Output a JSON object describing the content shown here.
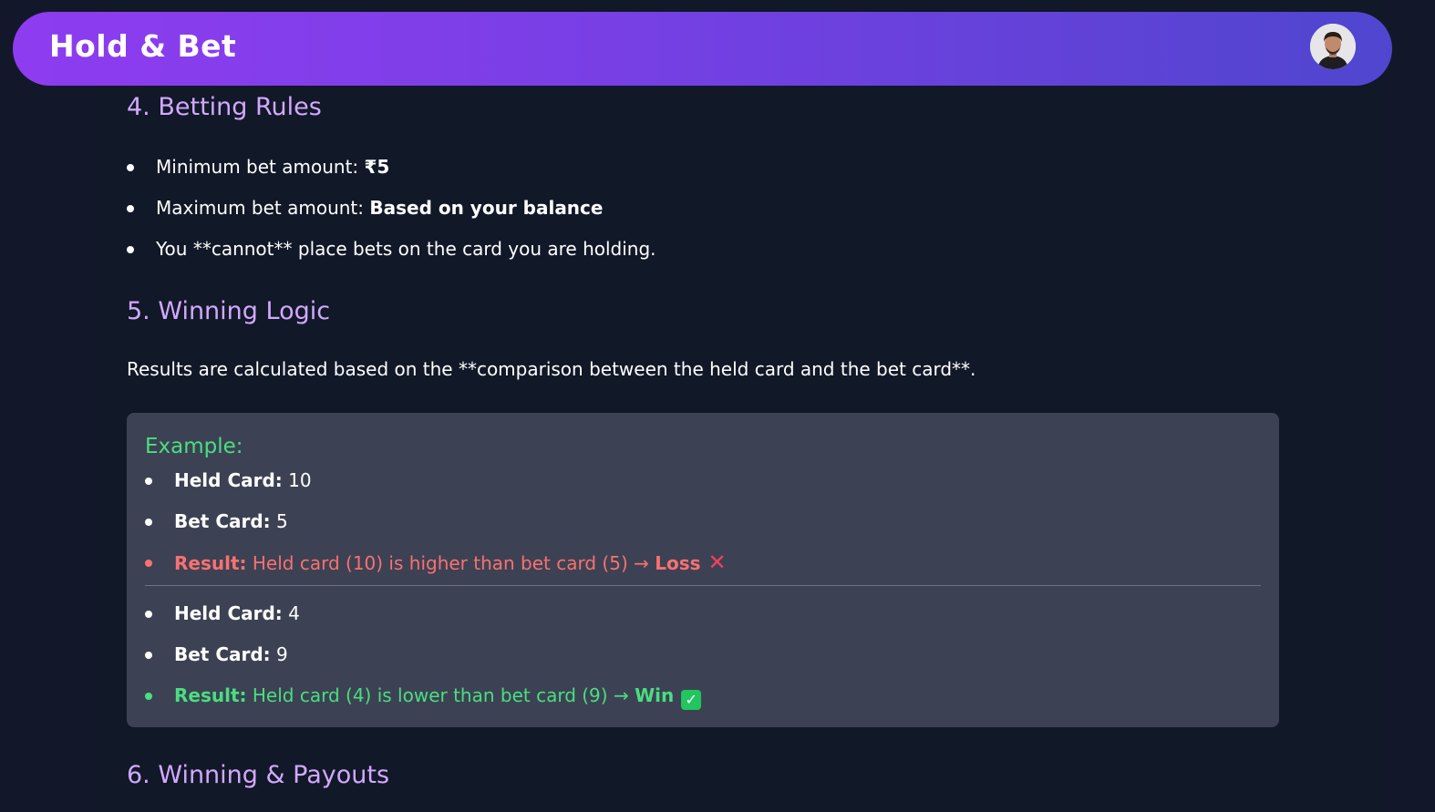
{
  "header": {
    "title": "Hold & Bet",
    "avatar_icon": "user-avatar"
  },
  "sections": {
    "betting_rules": {
      "heading": "4. Betting Rules",
      "items": [
        {
          "text": "Minimum bet amount: ",
          "bold": "₹5"
        },
        {
          "text": "Maximum bet amount: ",
          "bold": "Based on your balance"
        },
        {
          "text": "You **cannot** place bets on the card you are holding."
        }
      ]
    },
    "winning_logic": {
      "heading": "5. Winning Logic",
      "paragraph": "Results are calculated based on the **comparison between the held card and the bet card**.",
      "example": {
        "title": "Example:",
        "case1": {
          "held_label": "Held Card:",
          "held_value": " 10",
          "bet_label": "Bet Card:",
          "bet_value": " 5",
          "result_label": "Result:",
          "result_text": " Held card (10) is higher than bet card (5) → ",
          "result_outcome": "Loss",
          "result_icon": "✕"
        },
        "case2": {
          "held_label": "Held Card:",
          "held_value": " 4",
          "bet_label": "Bet Card:",
          "bet_value": " 9",
          "result_label": "Result:",
          "result_text": " Held card (4) is lower than bet card (9) → ",
          "result_outcome": "Win",
          "result_icon": "✓"
        }
      }
    },
    "payouts": {
      "heading": "6. Winning & Payouts"
    }
  },
  "colors": {
    "background": "#111827",
    "heading": "#d2a8ff",
    "loss": "#f87171",
    "win": "#4ade80",
    "example_box": "#3c4253"
  }
}
